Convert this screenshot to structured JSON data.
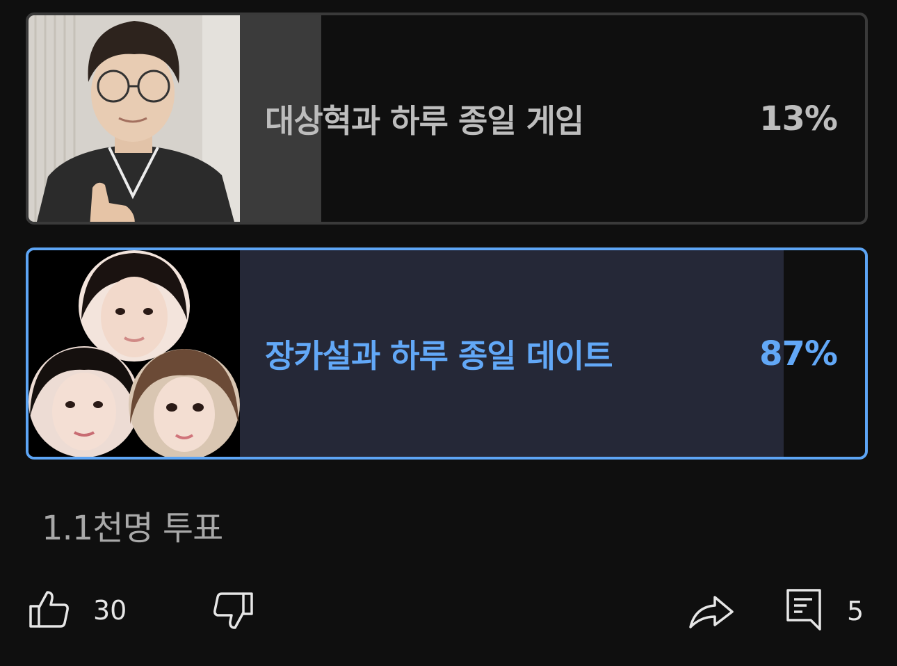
{
  "poll": {
    "options": [
      {
        "label": "대상혁과 하루 종일 게임",
        "percent_text": "13%",
        "percent": 13,
        "selected": false,
        "image_icon": "person-photo"
      },
      {
        "label": "장카설과 하루 종일 데이트",
        "percent_text": "87%",
        "percent": 87,
        "selected": true,
        "image_icon": "three-faces-collage"
      }
    ],
    "total_votes": "1.1천명 투표"
  },
  "actions": {
    "like_count": "30",
    "comment_count": "5"
  },
  "colors": {
    "background": "#0f0f0f",
    "selected_accent": "#5da5f5",
    "unselected_fill": "#3b3b3b",
    "selected_fill": "#252837"
  }
}
